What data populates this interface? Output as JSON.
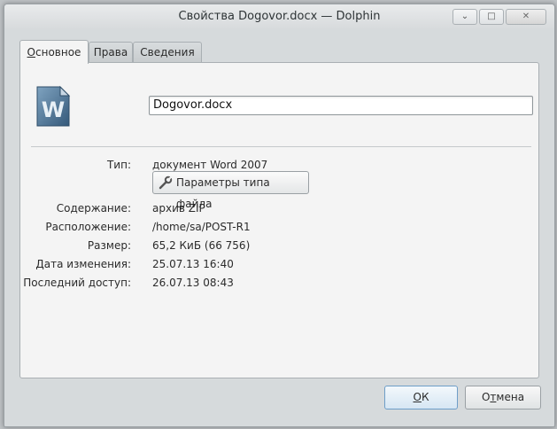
{
  "window": {
    "title": "Свойства Dogovor.docx — Dolphin"
  },
  "tabs": [
    {
      "label_mnemonic": "О",
      "label_rest": "сновное"
    },
    {
      "label": "Права"
    },
    {
      "label": "Сведения"
    }
  ],
  "file": {
    "icon": "word-document-icon",
    "name": "Dogovor.docx"
  },
  "properties": {
    "type": {
      "label": "Тип:",
      "value": "документ Word 2007"
    },
    "file_type_button": "Параметры типа файла",
    "contents": {
      "label": "Содержание:",
      "value": "архив ZIP"
    },
    "location": {
      "label": "Расположение:",
      "value": "/home/sa/POST-R1"
    },
    "size": {
      "label": "Размер:",
      "value": "65,2 КиБ (66 756)"
    },
    "modified": {
      "label": "Дата изменения:",
      "value": "25.07.13 16:40"
    },
    "accessed": {
      "label": "Последний доступ:",
      "value": "26.07.13 08:43"
    }
  },
  "buttons": {
    "ok_mnemonic": "О",
    "ok_rest": "К",
    "cancel_mnemonic": "т",
    "cancel_before": "О",
    "cancel_after": "мена"
  }
}
